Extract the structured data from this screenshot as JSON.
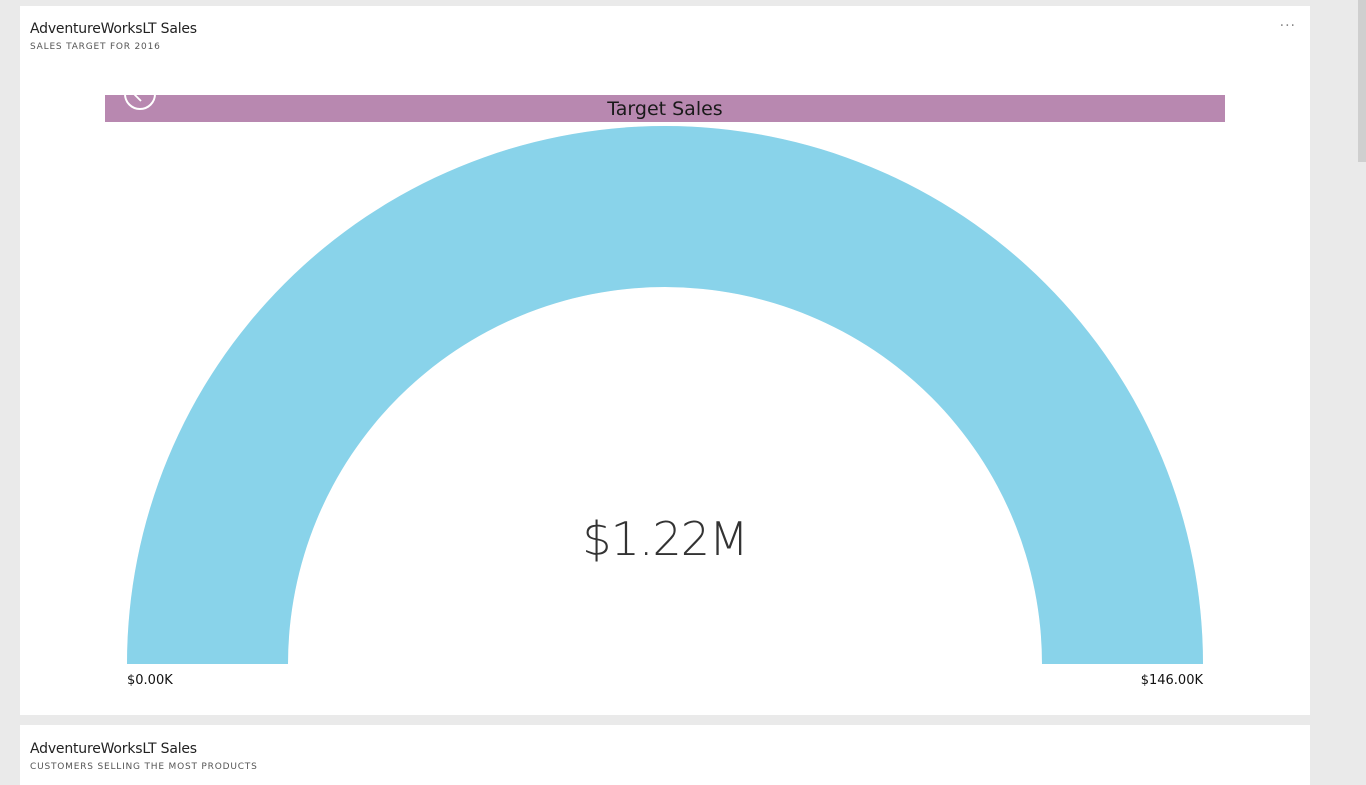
{
  "tiles": [
    {
      "title": "AdventureWorksLT Sales",
      "subtitle": "SALES TARGET FOR 2016",
      "more_label": "···"
    },
    {
      "title": "AdventureWorksLT Sales",
      "subtitle": "CUSTOMERS SELLING THE MOST PRODUCTS"
    }
  ],
  "gauge": {
    "header": "Target Sales",
    "value_label": "$1.22M",
    "min_label": "$0.00K",
    "max_label": "$146.00K",
    "fill_fraction": 1.0,
    "colors": {
      "fill": "#89d3ea",
      "header_bar": "#b888b0"
    }
  },
  "icons": {
    "back": "back-arrow-icon",
    "more": "more-options-icon"
  },
  "chart_data": {
    "type": "gauge",
    "title": "Target Sales",
    "value": 1220000,
    "value_label": "$1.22M",
    "min": 0,
    "max": 146000,
    "min_label": "$0.00K",
    "max_label": "$146.00K"
  }
}
